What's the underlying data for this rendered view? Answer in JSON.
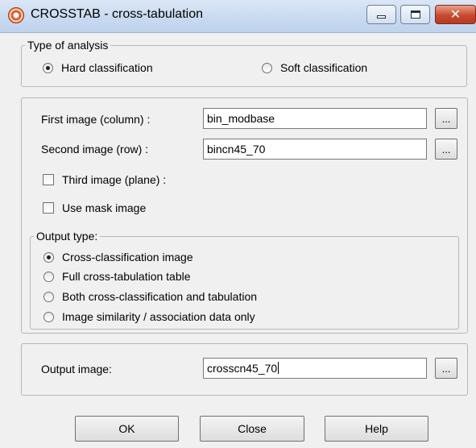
{
  "window": {
    "title": "CROSSTAB - cross-tabulation",
    "close_glyph": "✕",
    "icons": {
      "app": "crosstab-app-icon",
      "minimize": "minimize-icon",
      "maximize": "maximize-icon",
      "close": "close-icon"
    }
  },
  "analysis": {
    "legend": "Type of analysis",
    "options": [
      {
        "label": "Hard classification",
        "selected": true
      },
      {
        "label": "Soft classification",
        "selected": false
      }
    ]
  },
  "inputs": {
    "first_label": "First image (column) :",
    "first_value": "bin_modbase",
    "second_label": "Second image (row) :",
    "second_value": "bincn45_70",
    "browse_label": "...",
    "third_label": "Third image (plane) :",
    "third_checked": false,
    "mask_label": "Use mask image",
    "mask_checked": false
  },
  "output_type": {
    "legend": "Output type:",
    "options": [
      {
        "label": "Cross-classification image",
        "selected": true
      },
      {
        "label": "Full cross-tabulation table",
        "selected": false
      },
      {
        "label": "Both cross-classification and tabulation",
        "selected": false
      },
      {
        "label": "Image similarity / association data only",
        "selected": false
      }
    ]
  },
  "output": {
    "label": "Output image:",
    "value": "crosscn45_70"
  },
  "buttons": {
    "ok": "OK",
    "close": "Close",
    "help": "Help"
  }
}
